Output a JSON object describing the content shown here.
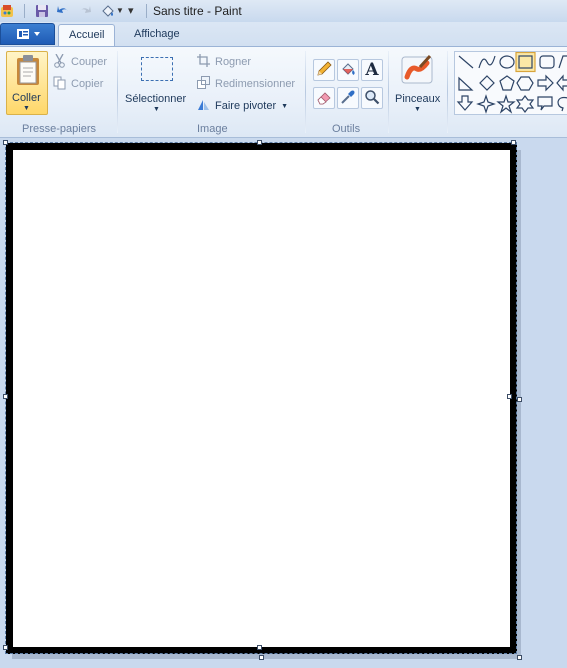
{
  "window": {
    "title": "Sans titre - Paint"
  },
  "tabs": [
    {
      "label": "Accueil",
      "active": true
    },
    {
      "label": "Affichage",
      "active": false
    }
  ],
  "clipboard": {
    "group_label": "Presse-papiers",
    "paste": "Coller",
    "cut": "Couper",
    "copy": "Copier"
  },
  "image": {
    "group_label": "Image",
    "select": "Sélectionner",
    "crop": "Rogner",
    "resize": "Redimensionner",
    "rotate": "Faire pivoter"
  },
  "tools": {
    "group_label": "Outils"
  },
  "brushes": {
    "label": "Pinceaux"
  },
  "colors": {
    "accent": "#1f5bb5",
    "canvas_border": "#000000",
    "workspace_bg": "#c9d9ee"
  }
}
